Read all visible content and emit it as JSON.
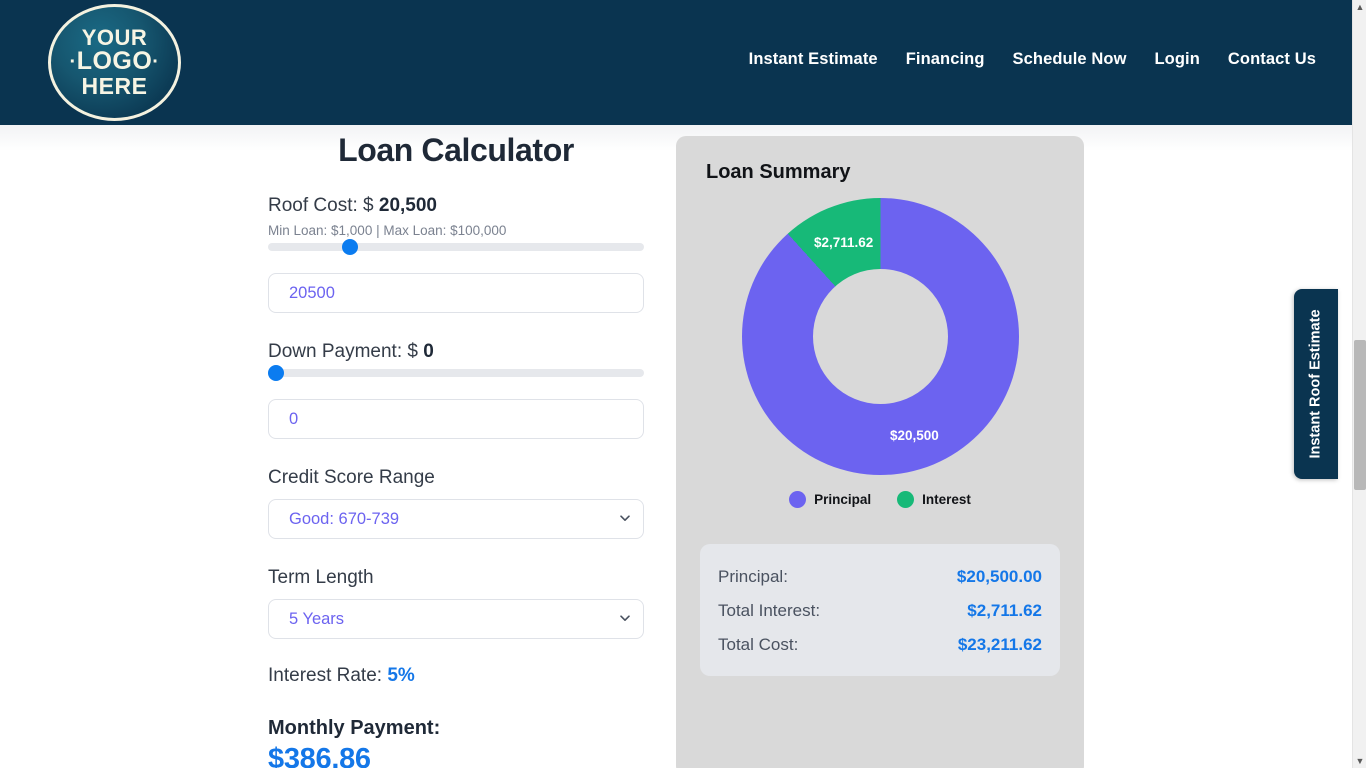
{
  "header": {
    "logo": {
      "line1": "YOUR",
      "line2": "LOGO",
      "line3": "HERE",
      "dot": "·"
    },
    "nav": [
      {
        "label": "Instant Estimate"
      },
      {
        "label": "Financing"
      },
      {
        "label": "Schedule Now"
      },
      {
        "label": "Login"
      },
      {
        "label": "Contact Us"
      }
    ],
    "bg_color": "#0a3450"
  },
  "calculator": {
    "title": "Loan Calculator",
    "roof_cost": {
      "label_prefix": "Roof Cost: $ ",
      "value_display": "20,500",
      "min_max": "Min Loan: $1,000   |   Max Loan: $100,000",
      "slider_percent": 20.5,
      "input_value": "20500"
    },
    "down_payment": {
      "label_prefix": "Down Payment: $ ",
      "value_display": "0",
      "slider_percent": 0,
      "input_value": "0"
    },
    "credit_score": {
      "label": "Credit Score Range",
      "selected": "Good: 670-739"
    },
    "term_length": {
      "label": "Term Length",
      "selected": "5 Years"
    },
    "interest": {
      "label_prefix": "Interest Rate: ",
      "rate": "5%"
    },
    "monthly": {
      "label": "Monthly Payment:",
      "value": "$386.86"
    }
  },
  "summary": {
    "title": "Loan Summary",
    "rows": [
      {
        "key": "Principal:",
        "value": "$20,500.00"
      },
      {
        "key": "Total Interest:",
        "value": "$2,711.62"
      },
      {
        "key": "Total Cost:",
        "value": "$23,211.62"
      }
    ]
  },
  "chart_data": {
    "type": "pie",
    "title": "Loan Summary",
    "categories": [
      "Principal",
      "Interest"
    ],
    "values": [
      20500,
      2711.62
    ],
    "labels": [
      "$20,500",
      "$2,711.62"
    ],
    "colors": [
      "#6c63f0",
      "#17b978"
    ],
    "legend_position": "bottom",
    "donut": true,
    "total": 23211.62,
    "percentages": [
      88.32,
      11.68
    ]
  },
  "side_tab": {
    "label": "Instant Roof Estimate"
  },
  "scrollbar": {
    "up_arrow": "▲",
    "down_arrow": "▼"
  }
}
